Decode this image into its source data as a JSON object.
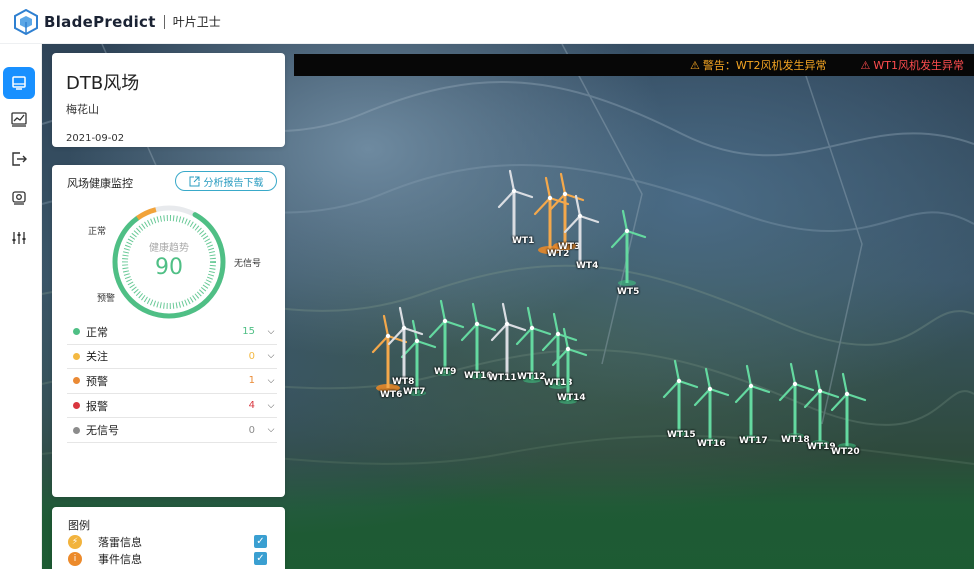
{
  "header": {
    "brand": "BladePredict",
    "subbrand": "叶片卫士"
  },
  "rail": {
    "items": [
      {
        "name": "dashboard",
        "icon": "monitor-icon",
        "active": true
      },
      {
        "name": "trend",
        "icon": "line-chart-icon",
        "active": false
      },
      {
        "name": "export",
        "icon": "logout-icon",
        "active": false
      },
      {
        "name": "camera",
        "icon": "webcam-icon",
        "active": false
      },
      {
        "name": "settings",
        "icon": "sliders-icon",
        "active": false
      }
    ]
  },
  "site": {
    "name": "DTB风场",
    "location": "梅花山",
    "date": "2021-09-02"
  },
  "alerts": [
    {
      "type": "warn",
      "icon": "warning-icon",
      "text": "警告：WT2风机发生异常"
    },
    {
      "type": "error",
      "icon": "warning-icon",
      "text": "WT1风机发生异常"
    }
  ],
  "health": {
    "title": "风场健康监控",
    "report_button": "分析报告下载",
    "gauge_label": "健康趋势",
    "score": "90",
    "score_fraction": 0.9,
    "gauge_labels": {
      "normal": "正常",
      "nosignal": "无信号",
      "warning": "预警"
    },
    "statuses": [
      {
        "label": "正常",
        "count": "15",
        "color": "#4fbf85"
      },
      {
        "label": "关注",
        "count": "0",
        "color": "#f4b942"
      },
      {
        "label": "预警",
        "count": "1",
        "color": "#ea8a35"
      },
      {
        "label": "报警",
        "count": "4",
        "color": "#d9363e"
      },
      {
        "label": "无信号",
        "count": "0",
        "color": "#8c8c8c"
      }
    ]
  },
  "legend": {
    "title": "图例",
    "items": [
      {
        "label": "落雷信息",
        "icon": "lightning-icon",
        "checked": true,
        "color": "#f2b33d"
      },
      {
        "label": "事件信息",
        "icon": "info-icon",
        "checked": true,
        "color": "#ec8a2b"
      }
    ]
  },
  "turbines": [
    {
      "id": "WT1",
      "state": "offline"
    },
    {
      "id": "WT2",
      "state": "alarm"
    },
    {
      "id": "WT3",
      "state": "alarm"
    },
    {
      "id": "WT4",
      "state": "offline"
    },
    {
      "id": "WT5",
      "state": "normal"
    },
    {
      "id": "WT6",
      "state": "alarm"
    },
    {
      "id": "WT7",
      "state": "normal"
    },
    {
      "id": "WT8",
      "state": "offline"
    },
    {
      "id": "WT9",
      "state": "normal"
    },
    {
      "id": "WT10",
      "state": "normal"
    },
    {
      "id": "WT11",
      "state": "offline"
    },
    {
      "id": "WT12",
      "state": "normal"
    },
    {
      "id": "WT13",
      "state": "normal"
    },
    {
      "id": "WT14",
      "state": "normal"
    },
    {
      "id": "WT15",
      "state": "normal"
    },
    {
      "id": "WT16",
      "state": "normal"
    },
    {
      "id": "WT17",
      "state": "normal"
    },
    {
      "id": "WT18",
      "state": "normal"
    },
    {
      "id": "WT19",
      "state": "normal"
    },
    {
      "id": "WT20",
      "state": "normal"
    }
  ]
}
